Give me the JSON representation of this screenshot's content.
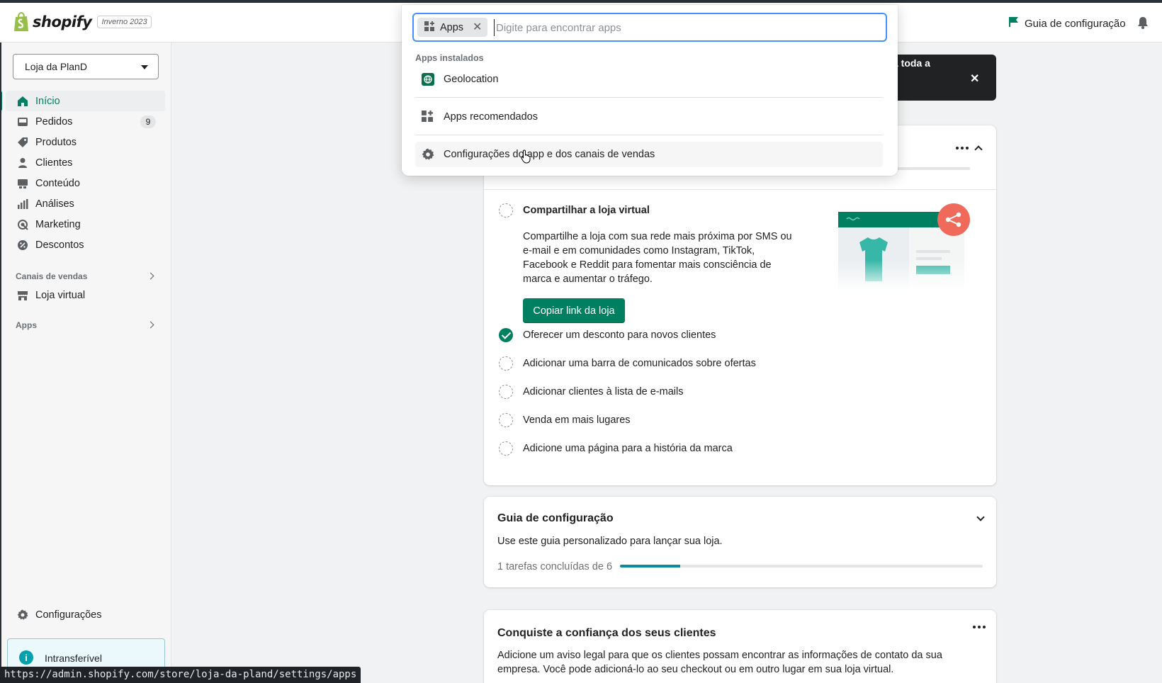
{
  "topbar": {
    "brand": "shopify",
    "edition": "Inverno 2023",
    "setup_guide": "Guia de configuração"
  },
  "sidebar": {
    "store_name": "Loja da PlanD",
    "items": [
      {
        "label": "Início",
        "icon": "home-icon",
        "active": true
      },
      {
        "label": "Pedidos",
        "icon": "orders-icon",
        "badge": "9"
      },
      {
        "label": "Produtos",
        "icon": "tag-icon"
      },
      {
        "label": "Clientes",
        "icon": "person-icon"
      },
      {
        "label": "Conteúdo",
        "icon": "content-icon"
      },
      {
        "label": "Análises",
        "icon": "analytics-icon"
      },
      {
        "label": "Marketing",
        "icon": "marketing-icon"
      },
      {
        "label": "Descontos",
        "icon": "discount-icon"
      }
    ],
    "sales_channels_heading": "Canais de vendas",
    "online_store": "Loja virtual",
    "apps_heading": "Apps",
    "settings": "Configurações",
    "nontransferable": "Intransferível"
  },
  "status_url": "https://admin.shopify.com/store/loja-da-pland/settings/apps",
  "banner": {
    "text": "a toda a"
  },
  "popover": {
    "chip_label": "Apps",
    "search_placeholder": "Digite para encontrar apps",
    "search_value": "",
    "installed_heading": "Apps instalados",
    "installed": [
      "Geolocation"
    ],
    "recommended": "Apps recomendados",
    "settings_link": "Configurações do app e dos canais de vendas"
  },
  "share_card": {
    "task_title": "Compartilhar a loja virtual",
    "description": "Compartilhe a loja com sua rede mais próxima por SMS ou e-mail e em comunidades como Instagram, TikTok, Facebook e Reddit para fomentar mais consciência de marca e aumentar o tráfego.",
    "button": "Copiar link da loja",
    "tasks": [
      {
        "label": "Oferecer um desconto para novos clientes",
        "done": true
      },
      {
        "label": "Adicionar uma barra de comunicados sobre ofertas",
        "done": false
      },
      {
        "label": "Adicionar clientes à lista de e-mails",
        "done": false
      },
      {
        "label": "Venda em mais lugares",
        "done": false
      },
      {
        "label": "Adicione uma página para a história da marca",
        "done": false
      }
    ]
  },
  "guide_card": {
    "title": "Guia de configuração",
    "subtitle": "Use este guia personalizado para lançar sua loja.",
    "progress_text": "1 tarefas concluídas de 6",
    "progress_fraction": 0.1667
  },
  "trust_card": {
    "title": "Conquiste a confiança dos seus clientes",
    "text": "Adicione um aviso legal para que os clientes possam encontrar as informações de contato da sua empresa. Você pode adicioná-lo ao seu checkout ou em outro lugar em sua loja virtual."
  },
  "colors": {
    "accent": "#008060",
    "focus": "#458fff",
    "progress": "#0e8a9e",
    "share_button": "#ef6a5a"
  }
}
